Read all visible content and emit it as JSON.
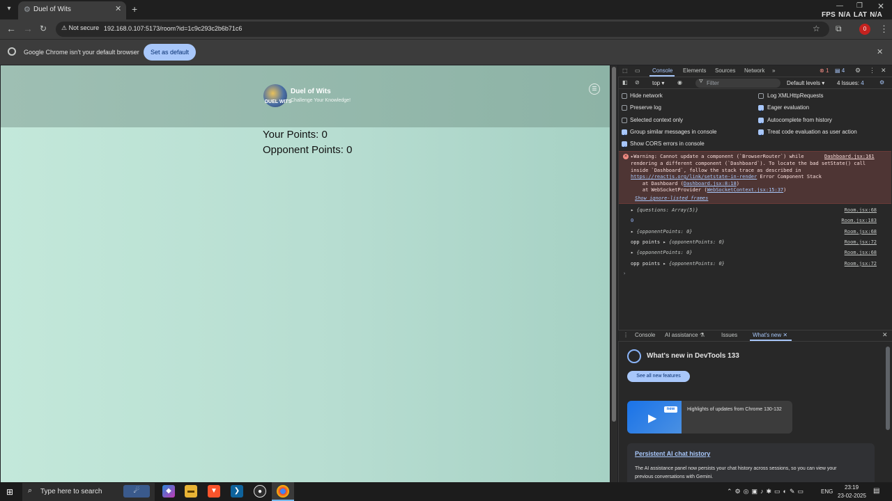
{
  "browser": {
    "tab_title": "Duel of Wits",
    "new_tab": "+",
    "overlay": {
      "fps_label": "FPS",
      "fps_value": "N/A",
      "lat_label": "LAT",
      "lat_value": "N/A"
    },
    "security_label": "Not secure",
    "url": "192.168.0.107:5173/room?id=1c9c293c2b6b71c6",
    "profile_badge": "0",
    "infobar_text": "Google Chrome isn't your default browser",
    "infobar_button": "Set as default"
  },
  "app": {
    "logo_text": "DUEL WITS",
    "title": "Duel of Wits",
    "subtitle": "Challenge Your Knowledge!",
    "your_points": "Your Points: 0",
    "opponent_points": "Opponent Points: 0"
  },
  "devtools": {
    "tabs": [
      "Console",
      "Elements",
      "Sources",
      "Network"
    ],
    "error_count": "1",
    "message_count": "4",
    "context": "top",
    "filter_placeholder": "Filter",
    "levels": "Default levels",
    "issues": "4 Issues:",
    "issues_count": "4",
    "options_left": [
      {
        "label": "Hide network",
        "checked": false
      },
      {
        "label": "Preserve log",
        "checked": false
      },
      {
        "label": "Selected context only",
        "checked": false
      },
      {
        "label": "Group similar messages in console",
        "checked": true
      },
      {
        "label": "Show CORS errors in console",
        "checked": true
      }
    ],
    "options_right": [
      {
        "label": "Log XMLHttpRequests",
        "checked": false
      },
      {
        "label": "Eager evaluation",
        "checked": true
      },
      {
        "label": "Autocomplete from history",
        "checked": true
      },
      {
        "label": "Treat code evaluation as user action",
        "checked": true
      }
    ],
    "warning": {
      "line1": "Warning: Cannot update a component (`BrowserRouter`) while",
      "line2": "rendering a different component (`Dashboard`). To locate the bad setState() call",
      "line3": "inside `Dashboard`, follow the stack trace as described in",
      "link": "https://reactjs.org/link/setstate-in-render",
      "line4_rest": " Error Component Stack",
      "line5_pre": "    at Dashboard (",
      "line5_link": "Dashboard.jsx:8:18",
      "line5_post": ")",
      "line6_pre": "    at WebSocketProvider (",
      "line6_link": "WebSocketContext.jsx:15:37",
      "line6_post": ")",
      "ignore_link": "Show ignore-listed frames",
      "source": "Dashboard.jsx:161"
    },
    "logs": [
      {
        "prefix": "",
        "text": "{questions: Array(5)}",
        "source": "Room.jsx:68",
        "expandable": true
      },
      {
        "prefix": "",
        "text": "0",
        "source": "Room.jsx:183",
        "expandable": false
      },
      {
        "prefix": "",
        "text": "{opponentPoints: 0}",
        "source": "Room.jsx:68",
        "expandable": true
      },
      {
        "prefix": "opp points",
        "text": "{opponentPoints: 0}",
        "source": "Room.jsx:72",
        "expandable": true
      },
      {
        "prefix": "",
        "text": "{opponentPoints: 0}",
        "source": "Room.jsx:68",
        "expandable": true
      },
      {
        "prefix": "opp points",
        "text": "{opponentPoints: 0}",
        "source": "Room.jsx:72",
        "expandable": true
      }
    ],
    "drawer_tabs": [
      "Console",
      "AI assistance",
      "Issues",
      "What's new"
    ],
    "whats_new": {
      "title": "What's new in DevTools 133",
      "button": "See all new features",
      "badge": "new",
      "card_text": "Highlights of updates from Chrome 130-132",
      "section_title": "Persistent AI chat history",
      "section_text1": "The AI assistance panel now persists your chat history across sessions, so you can view your",
      "section_text2": "previous conversations with Gemini."
    }
  },
  "taskbar": {
    "search_placeholder": "Type here to search",
    "lang": "ENG",
    "time": "23:19",
    "date": "23-02-2025"
  }
}
